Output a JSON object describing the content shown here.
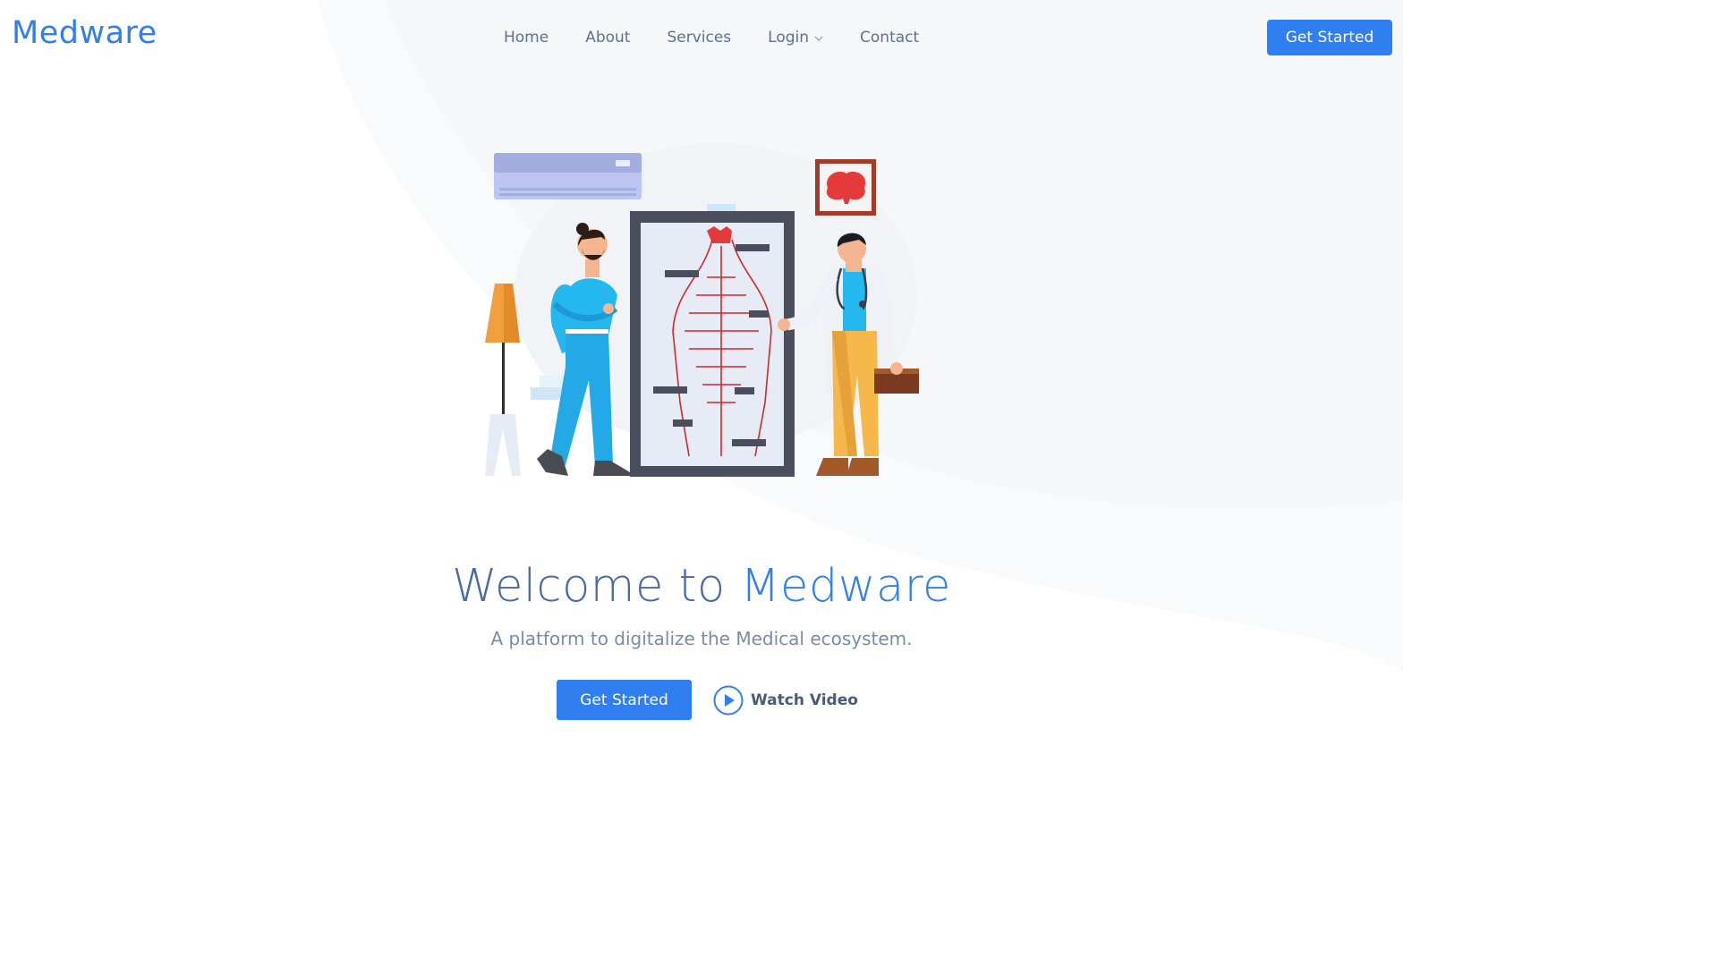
{
  "brand": {
    "name": "Medware",
    "accent_color": "#2f7ff0"
  },
  "nav": {
    "items": [
      {
        "label": "Home"
      },
      {
        "label": "About"
      },
      {
        "label": "Services"
      },
      {
        "label": "Login",
        "has_dropdown": true,
        "icon": "chevron-down-icon"
      },
      {
        "label": "Contact"
      }
    ]
  },
  "header": {
    "cta_label": "Get Started"
  },
  "hero": {
    "title_prefix": "Welcome to ",
    "title_brand": "Medware",
    "subtitle": "A platform to digitalize the Medical ecosystem.",
    "primary_cta": "Get Started",
    "secondary_cta": "Watch Video",
    "secondary_icon": "play-circle-icon"
  }
}
